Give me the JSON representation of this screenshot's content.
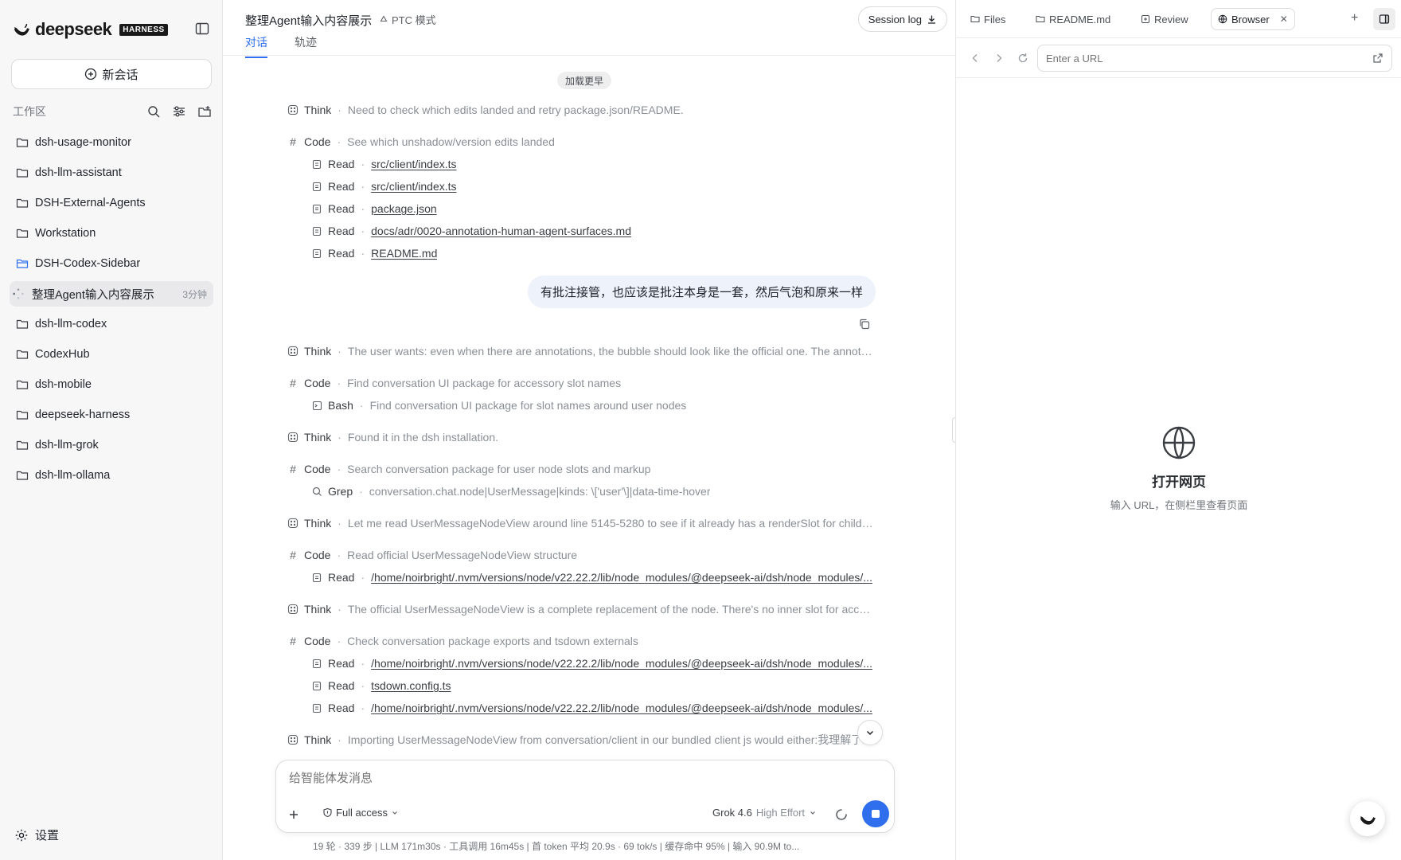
{
  "brand": {
    "name": "deepseek",
    "badge": "HARNESS"
  },
  "sidebar": {
    "new_chat": "新会话",
    "workspace_label": "工作区",
    "items": [
      {
        "label": "dsh-usage-monitor"
      },
      {
        "label": "dsh-llm-assistant"
      },
      {
        "label": "DSH-External-Agents"
      },
      {
        "label": "Workstation"
      },
      {
        "label": "DSH-Codex-Sidebar",
        "open": true
      },
      {
        "label": "整理Agent输入内容展示",
        "time": "3分钟",
        "child": true
      },
      {
        "label": "dsh-llm-codex"
      },
      {
        "label": "CodexHub"
      },
      {
        "label": "dsh-mobile"
      },
      {
        "label": "deepseek-harness"
      },
      {
        "label": "dsh-llm-grok"
      },
      {
        "label": "dsh-llm-ollama"
      }
    ],
    "settings": "设置"
  },
  "header": {
    "title": "整理Agent输入内容展示",
    "mode": "PTC 模式",
    "tabs": [
      "对话",
      "轨迹"
    ],
    "session_log": "Session log"
  },
  "feed": {
    "load_more": "加载更早",
    "think1": {
      "kind": "Think",
      "text": "Need to check which edits landed and retry package.json/README."
    },
    "code1": {
      "kind": "Code",
      "text": "See which unshadow/version edits landed"
    },
    "reads1": [
      {
        "kind": "Read",
        "path": "src/client/index.ts"
      },
      {
        "kind": "Read",
        "path": "src/client/index.ts"
      },
      {
        "kind": "Read",
        "path": "package.json"
      },
      {
        "kind": "Read",
        "path": "docs/adr/0020-annotation-human-agent-surfaces.md"
      },
      {
        "kind": "Read",
        "path": "README.md"
      }
    ],
    "user_message": "有批注接管，也应该是批注本身是一套，然后气泡和原来一样",
    "think2": {
      "kind": "Think",
      "text": "The user wants: even when there are annotations, the bubble should look like the official one. The annotati..."
    },
    "code2": {
      "kind": "Code",
      "text": "Find conversation UI package for accessory slot names"
    },
    "bash1": {
      "kind": "Bash",
      "text": "Find conversation UI package for slot names around user nodes"
    },
    "think3": {
      "kind": "Think",
      "text": "Found it in the dsh installation."
    },
    "code3": {
      "kind": "Code",
      "text": "Search conversation package for user node slots and markup"
    },
    "grep1": {
      "kind": "Grep",
      "text": "conversation.chat.node|UserMessage|kinds: \\['user'\\]|data-time-hover"
    },
    "think4": {
      "kind": "Think",
      "text": "Let me read UserMessageNodeView around line 5145-5280 to see if it already has a renderSlot for childre..."
    },
    "code4": {
      "kind": "Code",
      "text": "Read official UserMessageNodeView structure"
    },
    "read2": {
      "kind": "Read",
      "path": "/home/noirbright/.nvm/versions/node/v22.22.2/lib/node_modules/@deepseek-ai/dsh/node_modules/..."
    },
    "think5": {
      "kind": "Think",
      "text": "The official UserMessageNodeView is a complete replacement of the node. There's no inner slot for acces..."
    },
    "code5": {
      "kind": "Code",
      "text": "Check conversation package exports and tsdown externals"
    },
    "reads3": [
      {
        "kind": "Read",
        "path": "/home/noirbright/.nvm/versions/node/v22.22.2/lib/node_modules/@deepseek-ai/dsh/node_modules/..."
      },
      {
        "kind": "Read",
        "path": "tsdown.config.ts"
      },
      {
        "kind": "Read",
        "path": "/home/noirbright/.nvm/versions/node/v22.22.2/lib/node_modules/@deepseek-ai/dsh/node_modules/..."
      }
    ],
    "think6": {
      "kind": "Think",
      "text": "Importing UserMessageNodeView from conversation/client in our bundled client js would either:我理解了..."
    }
  },
  "composer": {
    "placeholder": "给智能体发消息",
    "access": "Full access",
    "model": "Grok 4.6",
    "effort": "High Effort"
  },
  "stats": "19 轮 · 339 步   |   LLM 171m30s · 工具调用 16m45s   |   首 token 平均 20.9s · 69 tok/s   |   缓存命中 95%   |   输入 90.9M to...",
  "right": {
    "tabs": [
      "Files",
      "README.md",
      "Review",
      "Browser"
    ],
    "url_placeholder": "Enter a URL",
    "empty_title": "打开网页",
    "empty_sub": "输入 URL，在侧栏里查看页面"
  },
  "colors": {
    "accent": "#2f6fed",
    "bubble": "#eef2fb",
    "sidebar_bg": "#f7f7f8"
  }
}
